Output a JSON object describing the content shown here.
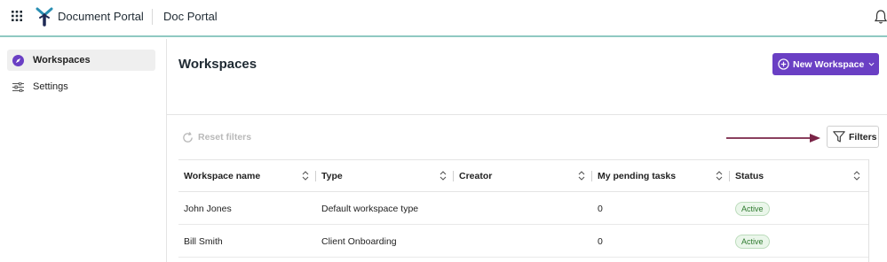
{
  "header": {
    "app_name": "Document Portal",
    "portal_name": "Doc Portal"
  },
  "sidebar": {
    "items": [
      {
        "label": "Workspaces",
        "icon": "compass-icon",
        "active": true
      },
      {
        "label": "Settings",
        "icon": "sliders-icon",
        "active": false
      }
    ]
  },
  "main": {
    "title": "Workspaces",
    "new_button_label": "New Workspace",
    "reset_filters_label": "Reset filters",
    "filters_label": "Filters"
  },
  "table": {
    "columns": [
      "Workspace name",
      "Type",
      "Creator",
      "My pending tasks",
      "Status"
    ],
    "rows": [
      {
        "name": "John Jones",
        "type": "Default workspace type",
        "creator": "",
        "pending": "0",
        "status": "Active"
      },
      {
        "name": "Bill Smith",
        "type": "Client Onboarding",
        "creator": "",
        "pending": "0",
        "status": "Active"
      }
    ]
  },
  "colors": {
    "accent": "#6a3fc4",
    "header_border": "#8fc9c2",
    "arrow": "#7a2447",
    "status_active_bg": "#eaf6ea",
    "status_active_text": "#2f7a2f"
  }
}
